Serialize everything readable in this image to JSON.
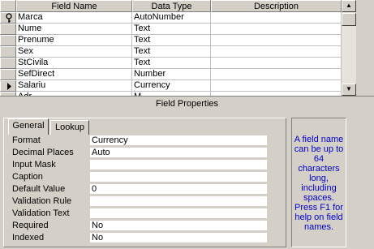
{
  "grid": {
    "columns": [
      "Field Name",
      "Data Type",
      "Description"
    ],
    "rows": [
      {
        "name": "Marca",
        "type": "AutoNumber",
        "description": "",
        "indicator": "key-icon"
      },
      {
        "name": "Nume",
        "type": "Text",
        "description": "",
        "indicator": ""
      },
      {
        "name": "Prenume",
        "type": "Text",
        "description": "",
        "indicator": ""
      },
      {
        "name": "Sex",
        "type": "Text",
        "description": "",
        "indicator": ""
      },
      {
        "name": "StCivila",
        "type": "Text",
        "description": "",
        "indicator": ""
      },
      {
        "name": "SefDirect",
        "type": "Number",
        "description": "",
        "indicator": ""
      },
      {
        "name": "Salariu",
        "type": "Currency",
        "description": "",
        "indicator": "current-row-arrow-icon"
      },
      {
        "name": "Adr...",
        "type": "M...",
        "description": "",
        "indicator": ""
      }
    ],
    "selected_row": 6
  },
  "field_properties": {
    "title": "Field Properties",
    "tabs": [
      "General",
      "Lookup"
    ],
    "active_tab": "General",
    "properties": [
      {
        "label": "Format",
        "value": "Currency"
      },
      {
        "label": "Decimal Places",
        "value": "Auto"
      },
      {
        "label": "Input Mask",
        "value": ""
      },
      {
        "label": "Caption",
        "value": ""
      },
      {
        "label": "Default Value",
        "value": "0"
      },
      {
        "label": "Validation Rule",
        "value": ""
      },
      {
        "label": "Validation Text",
        "value": ""
      },
      {
        "label": "Required",
        "value": "No"
      },
      {
        "label": "Indexed",
        "value": "No"
      }
    ],
    "help_text": "A field name can be up to 64 characters long, including spaces. Press F1 for help on field names."
  },
  "colors": {
    "help_text": "#0000c8",
    "background": "#d4d0c8"
  }
}
